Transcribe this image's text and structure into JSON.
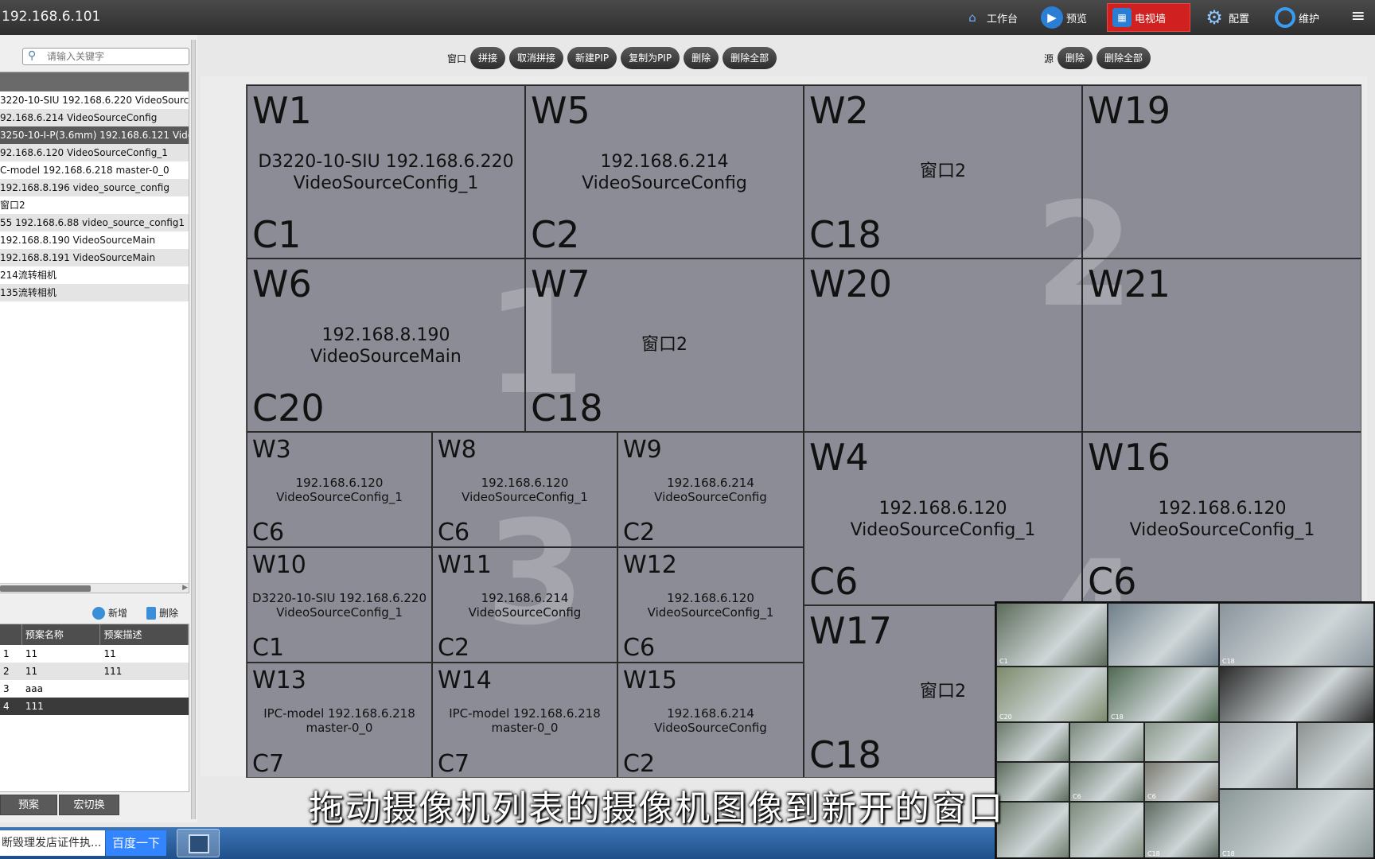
{
  "topbar": {
    "host": "192.168.6.101",
    "nav": [
      {
        "label": "工作台",
        "icon": "home-icon"
      },
      {
        "label": "预览",
        "icon": "play-icon"
      },
      {
        "label": "电视墙",
        "icon": "tv-wall-icon"
      },
      {
        "label": "配置",
        "icon": "gear-icon"
      },
      {
        "label": "维护",
        "icon": "maintenance-icon"
      }
    ],
    "active_nav": "电视墙",
    "menu_icon": "hamburger-menu-icon"
  },
  "left": {
    "search_placeholder": "请输入关键字",
    "sources": [
      "3220-10-SIU 192.168.6.220 VideoSourceCo",
      "92.168.6.214 VideoSourceConfig",
      "3250-10-I-P(3.6mm) 192.168.6.121 VideoSo",
      "92.168.6.120 VideoSourceConfig_1",
      "C-model 192.168.6.218 master-0_0",
      " 192.168.8.196 video_source_config",
      "窗口2",
      "55 192.168.6.88 video_source_config1",
      "192.168.8.190 VideoSourceMain",
      "192.168.8.191 VideoSourceMain",
      "214流转相机",
      "135流转相机"
    ],
    "add_label": "新增",
    "delete_label": "删除",
    "plan_headers": [
      "",
      "预案名称",
      "预案描述"
    ],
    "plans": [
      [
        "1",
        "11",
        "11"
      ],
      [
        "2",
        "11",
        "111"
      ],
      [
        "3",
        "aaa",
        ""
      ],
      [
        "4",
        "111",
        ""
      ]
    ],
    "tabs": [
      "预案",
      "宏切换"
    ]
  },
  "toolbar": {
    "window_label": "窗口",
    "window_buttons": [
      "拼接",
      "取消拼接",
      "新建PIP",
      "复制为PIP",
      "删除",
      "删除全部"
    ],
    "source_label": "源",
    "source_buttons": [
      "删除",
      "删除全部"
    ]
  },
  "wall": {
    "screen_numbers": [
      "1",
      "2",
      "3",
      "4"
    ],
    "windows": [
      {
        "w": "W1",
        "c": "C1",
        "src1": "D3220-10-SIU 192.168.6.220",
        "src2": "VideoSourceConfig_1"
      },
      {
        "w": "W5",
        "c": "C2",
        "src1": "192.168.6.214",
        "src2": "VideoSourceConfig"
      },
      {
        "w": "W2",
        "c": "C18",
        "src1": "窗口2",
        "src2": ""
      },
      {
        "w": "W19",
        "c": "",
        "src1": "",
        "src2": ""
      },
      {
        "w": "W6",
        "c": "C20",
        "src1": "192.168.8.190",
        "src2": "VideoSourceMain"
      },
      {
        "w": "W7",
        "c": "C18",
        "src1": "窗口2",
        "src2": ""
      },
      {
        "w": "W20",
        "c": "",
        "src1": "",
        "src2": ""
      },
      {
        "w": "W21",
        "c": "",
        "src1": "",
        "src2": ""
      },
      {
        "w": "W3",
        "c": "C6",
        "src1": "192.168.6.120",
        "src2": "VideoSourceConfig_1"
      },
      {
        "w": "W8",
        "c": "C6",
        "src1": "192.168.6.120",
        "src2": "VideoSourceConfig_1"
      },
      {
        "w": "W9",
        "c": "C2",
        "src1": "192.168.6.214",
        "src2": "VideoSourceConfig"
      },
      {
        "w": "W4",
        "c": "C6",
        "src1": "192.168.6.120",
        "src2": "VideoSourceConfig_1"
      },
      {
        "w": "W16",
        "c": "C6",
        "src1": "192.168.6.120",
        "src2": "VideoSourceConfig_1"
      },
      {
        "w": "W10",
        "c": "C1",
        "src1": "D3220-10-SIU 192.168.6.220",
        "src2": "VideoSourceConfig_1"
      },
      {
        "w": "W11",
        "c": "C2",
        "src1": "192.168.6.214",
        "src2": "VideoSourceConfig"
      },
      {
        "w": "W12",
        "c": "C6",
        "src1": "192.168.6.120",
        "src2": "VideoSourceConfig_1"
      },
      {
        "w": "W17",
        "c": "C18",
        "src1": "窗口2",
        "src2": ""
      },
      {
        "w": "W13",
        "c": "C7",
        "src1": "IPC-model 192.168.6.218",
        "src2": "master-0_0"
      },
      {
        "w": "W14",
        "c": "C7",
        "src1": "IPC-model 192.168.6.218",
        "src2": "master-0_0"
      },
      {
        "w": "W15",
        "c": "C2",
        "src1": "192.168.6.214",
        "src2": "VideoSourceConfig"
      }
    ]
  },
  "preview": {
    "labels": [
      "C1",
      "",
      "C18",
      "C20",
      "C18",
      "",
      "",
      "",
      "",
      "",
      "C6",
      "C6",
      "",
      "",
      "",
      "",
      "C18",
      "C18"
    ]
  },
  "taskbar": {
    "input_text": "断毁理发店证件执...",
    "button_label": "百度一下"
  },
  "subtitle": "拖动摄像机列表的摄像机图像到新开的窗口",
  "colors": {
    "active_nav": "#d02020",
    "wall_bg": "#8c8c96"
  }
}
